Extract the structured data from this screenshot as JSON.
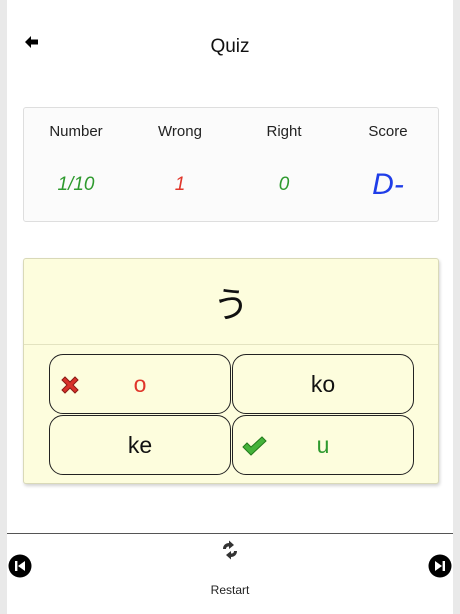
{
  "header": {
    "title": "Quiz"
  },
  "stats": {
    "number_label": "Number",
    "number_value": "1/10",
    "wrong_label": "Wrong",
    "wrong_value": "1",
    "right_label": "Right",
    "right_value": "0",
    "score_label": "Score",
    "score_value": "D-"
  },
  "question": {
    "character": "う"
  },
  "answers": [
    {
      "label": "o",
      "state": "wrong",
      "icon": "cross-icon"
    },
    {
      "label": "ko",
      "state": "neutral"
    },
    {
      "label": "ke",
      "state": "neutral"
    },
    {
      "label": "u",
      "state": "correct",
      "icon": "check-icon"
    }
  ],
  "footer": {
    "restart_label": "Restart"
  },
  "colors": {
    "green": "#2e9a2e",
    "red": "#e0362a",
    "blue": "#1f3de8",
    "card": "#fdfddd"
  }
}
